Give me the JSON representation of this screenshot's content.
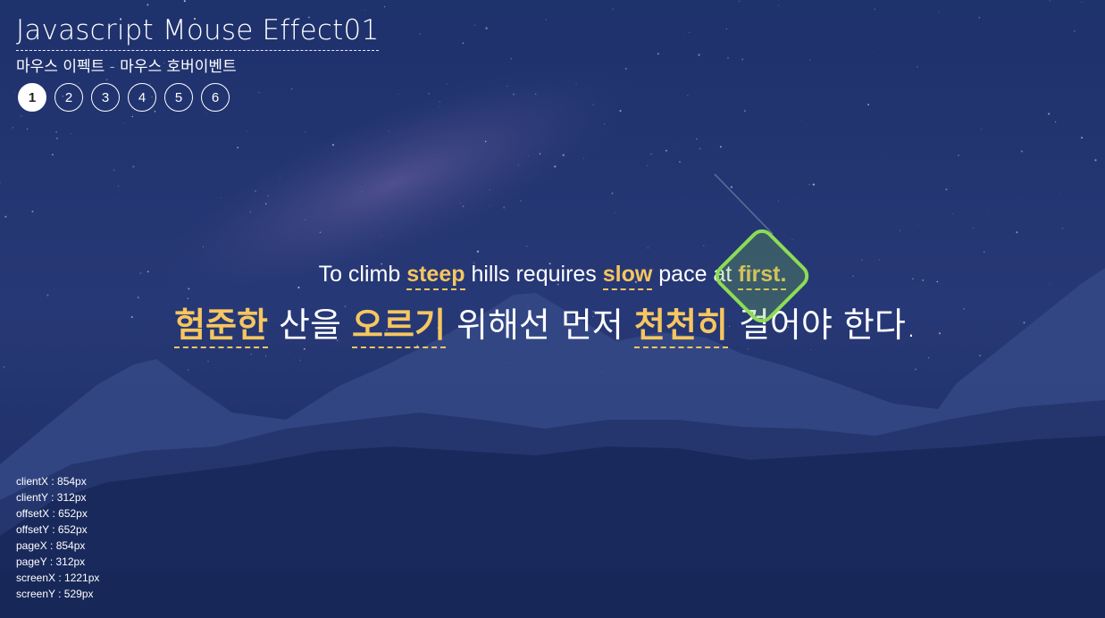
{
  "header": {
    "title": "Javascript Mouse Effect01",
    "subtitle": "마우스 이펙트 - 마우스 호버이벤트"
  },
  "pager": {
    "items": [
      "1",
      "2",
      "3",
      "4",
      "5",
      "6"
    ],
    "active": 0
  },
  "quote": {
    "en": {
      "t0": "To climb ",
      "h1": "steep",
      "t1": " hills requires ",
      "h2": "slow",
      "t2": " pace at ",
      "h3": "first."
    },
    "ko": {
      "h1": "험준한",
      "t1": " 산을 ",
      "h2": "오르기",
      "t2": " 위해선 먼저 ",
      "h3": "천천히",
      "t3": " 걸어야 한다."
    }
  },
  "info": {
    "clientX": "clientX : 854px",
    "clientY": "clientY : 312px",
    "offsetX": "offsetX : 652px",
    "offsetY": "offsetY : 652px",
    "pageX": "pageX : 854px",
    "pageY": "pageY : 312px",
    "screenX": "screenX : 1221px",
    "screenY": "screenY : 529px"
  },
  "colors": {
    "highlight": "#f6c660",
    "cursor_border": "#8ddc55",
    "sky_top": "#22356e",
    "mountain": "#1a2c5c"
  },
  "cursor": {
    "shape": "rotated-rounded-square"
  }
}
